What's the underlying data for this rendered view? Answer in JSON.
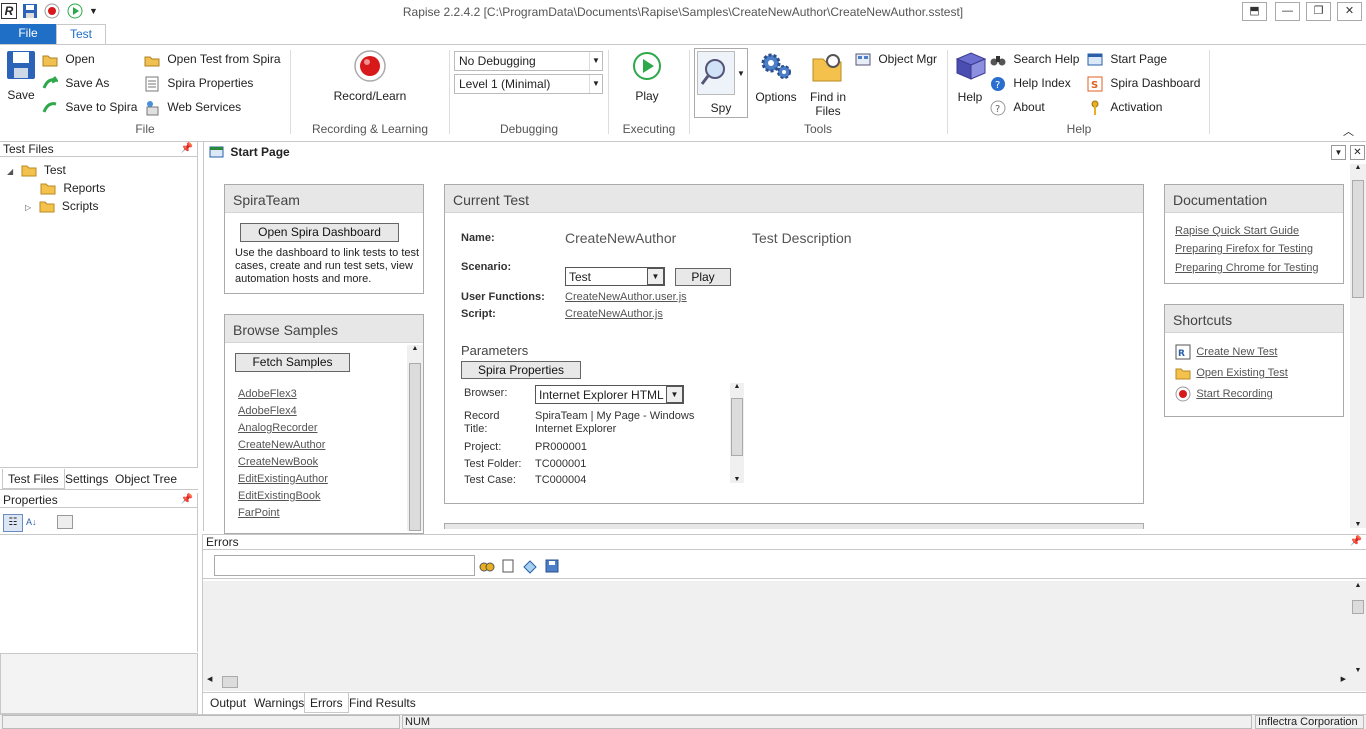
{
  "window": {
    "title": "Rapise 2.2.4.2 [C:\\ProgramData\\Documents\\Rapise\\Samples\\CreateNewAuthor\\CreateNewAuthor.sstest]"
  },
  "tabs": {
    "file": "File",
    "test": "Test"
  },
  "ribbon": {
    "file": {
      "save": "Save",
      "open": "Open",
      "save_as": "Save As",
      "save_to_spira": "Save to Spira",
      "open_from_spira": "Open Test from Spira",
      "spira_properties": "Spira Properties",
      "web_services": "Web Services",
      "group": "File"
    },
    "recording": {
      "record_learn": "Record/Learn",
      "group": "Recording & Learning"
    },
    "debugging": {
      "debug_mode": "No Debugging",
      "level": "Level 1 (Minimal)",
      "group": "Debugging"
    },
    "executing": {
      "play": "Play",
      "group": "Executing"
    },
    "tools": {
      "spy": "Spy",
      "options": "Options",
      "find_in_files_1": "Find in",
      "find_in_files_2": "Files",
      "object_mgr": "Object Mgr",
      "group": "Tools"
    },
    "help": {
      "help": "Help",
      "search_help": "Search Help",
      "help_index": "Help Index",
      "about": "About",
      "start_page": "Start Page",
      "spira_dashboard": "Spira Dashboard",
      "activation": "Activation",
      "group": "Help"
    }
  },
  "test_files": {
    "header": "Test Files",
    "tree": {
      "root": "Test",
      "reports": "Reports",
      "scripts": "Scripts"
    },
    "tabs": [
      "Test Files",
      "Settings",
      "Object Tree"
    ]
  },
  "properties": {
    "header": "Properties"
  },
  "start_page": {
    "tab_title": "Start Page",
    "spirateam": {
      "title": "SpiraTeam",
      "button": "Open Spira Dashboard",
      "desc": "Use the dashboard to link tests to test cases, create and run test sets, view automation hosts and more."
    },
    "browse": {
      "title": "Browse Samples",
      "button": "Fetch Samples",
      "samples": [
        "AdobeFlex3",
        "AdobeFlex4",
        "AnalogRecorder",
        "CreateNewAuthor",
        "CreateNewBook",
        "EditExistingAuthor",
        "EditExistingBook",
        "FarPoint"
      ]
    },
    "current": {
      "title": "Current Test",
      "name_label": "Name:",
      "name_value": "CreateNewAuthor",
      "desc_label": "Test Description",
      "scenario_label": "Scenario:",
      "scenario_value": "Test",
      "play": "Play",
      "uf_label": "User Functions:",
      "uf_value": "CreateNewAuthor.user.js",
      "script_label": "Script:",
      "script_value": "CreateNewAuthor.js",
      "params_title": "Parameters",
      "spira_props": "Spira Properties",
      "browser_label": "Browser:",
      "browser_value": "Internet Explorer HTML",
      "record_title_label_1": "Record",
      "record_title_label_2": "Title:",
      "record_title_value_1": "SpiraTeam | My Page - Windows",
      "record_title_value_2": "Internet Explorer",
      "project_label": "Project:",
      "project_value": "PR000001",
      "folder_label": "Test Folder:",
      "folder_value": "TC000001",
      "case_label": "Test Case:",
      "case_value": "TC000004"
    },
    "docs": {
      "title": "Documentation",
      "links": [
        "Rapise Quick Start Guide",
        "Preparing Firefox for Testing",
        "Preparing Chrome for Testing"
      ]
    },
    "shortcuts": {
      "title": "Shortcuts",
      "links": [
        "Create New Test",
        "Open Existing Test",
        "Start Recording"
      ]
    }
  },
  "errors": {
    "header": "Errors",
    "tabs": [
      "Output",
      "Warnings",
      "Errors",
      "Find Results"
    ]
  },
  "status": {
    "num": "NUM",
    "company": "Inflectra Corporation"
  },
  "colors": {
    "accent": "#1f6fc6",
    "record_red": "#d8191b",
    "play_green": "#2da84a"
  }
}
